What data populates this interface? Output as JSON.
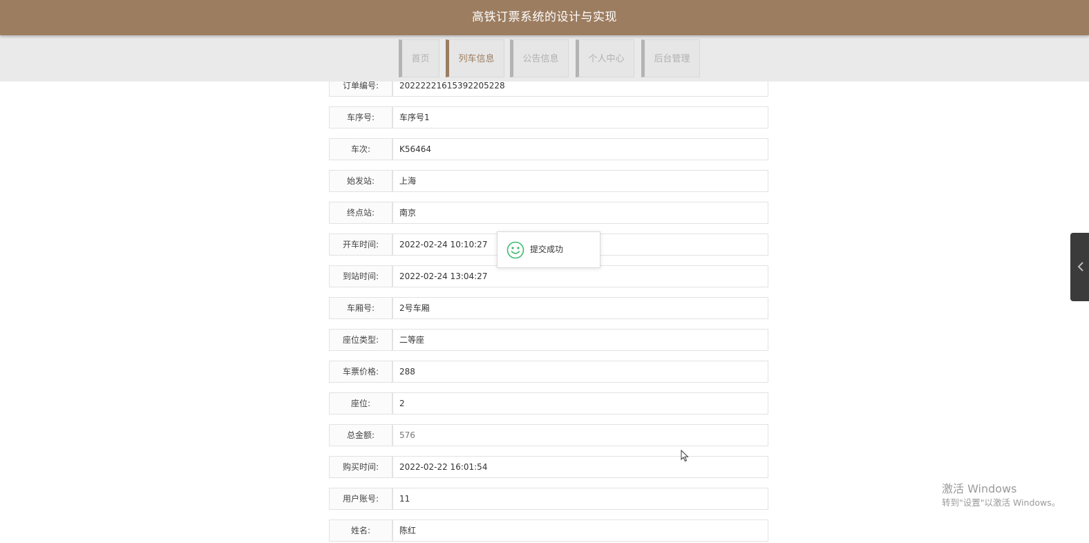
{
  "header": {
    "title": "高铁订票系统的设计与实现"
  },
  "nav": {
    "items": [
      {
        "label": "首页"
      },
      {
        "label": "列车信息"
      },
      {
        "label": "公告信息"
      },
      {
        "label": "个人中心"
      },
      {
        "label": "后台管理"
      }
    ],
    "active": "列车信息"
  },
  "form": {
    "fields": [
      {
        "label": "订单编号:",
        "value": "20222221615392205228"
      },
      {
        "label": "车序号:",
        "value": "车序号1"
      },
      {
        "label": "车次:",
        "value": "K56464"
      },
      {
        "label": "始发站:",
        "value": "上海"
      },
      {
        "label": "终点站:",
        "value": "南京"
      },
      {
        "label": "开车时间:",
        "value": "2022-02-24 10:10:27"
      },
      {
        "label": "到站时间:",
        "value": "2022-02-24 13:04:27"
      },
      {
        "label": "车厢号:",
        "value": "2号车厢"
      },
      {
        "label": "座位类型:",
        "value": "二等座"
      },
      {
        "label": "车票价格:",
        "value": "288"
      },
      {
        "label": "座位:",
        "value": "2"
      },
      {
        "label": "总金额:",
        "value": "576"
      },
      {
        "label": "购买时间:",
        "value": "2022-02-22 16:01:54"
      },
      {
        "label": "用户账号:",
        "value": "11"
      },
      {
        "label": "姓名:",
        "value": "陈红"
      }
    ]
  },
  "toast": {
    "message": "提交成功",
    "icon": "smile-icon"
  },
  "watermark": {
    "line1": "激活 Windows",
    "line2": "转到\"设置\"以激活 Windows。"
  },
  "colors": {
    "brand": "#9c7d60",
    "toast_icon": "#3dba6f",
    "nav_bg": "#eaeaea"
  }
}
